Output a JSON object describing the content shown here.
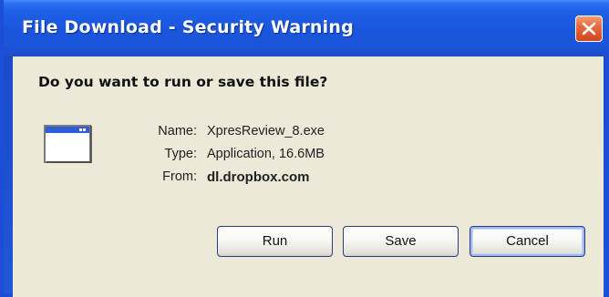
{
  "window": {
    "title": "File Download - Security Warning"
  },
  "dialog": {
    "question": "Do you want to run or save this file?",
    "file_icon": "application-window-icon",
    "fields": [
      {
        "label": "Name:",
        "value": "XpresReview_8.exe"
      },
      {
        "label": "Type:",
        "value": "Application, 16.6MB"
      },
      {
        "label": "From:",
        "value": "dl.dropbox.com"
      }
    ]
  },
  "buttons": {
    "run": "Run",
    "save": "Save",
    "cancel": "Cancel"
  },
  "colors": {
    "titlebar": "#1b55d9",
    "close": "#d2441f",
    "client": "#ece9d8"
  }
}
